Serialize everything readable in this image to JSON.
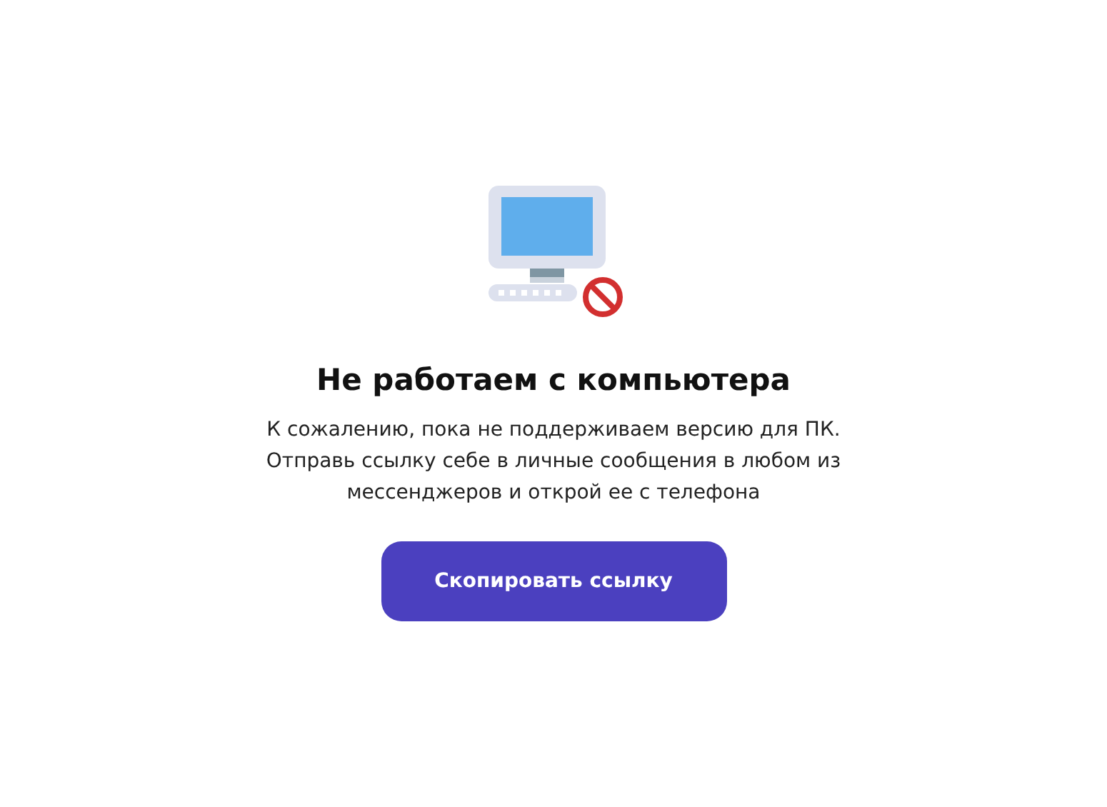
{
  "title": "Не работаем с компьютера",
  "message_lines": [
    "К сожалению, пока не поддерживаем версию для ПК.",
    "Отправь ссылку себе в личные сообщения в любом из",
    "мессенджеров и открой ее с телефона"
  ],
  "button": {
    "label": "Скопировать ссылку"
  }
}
